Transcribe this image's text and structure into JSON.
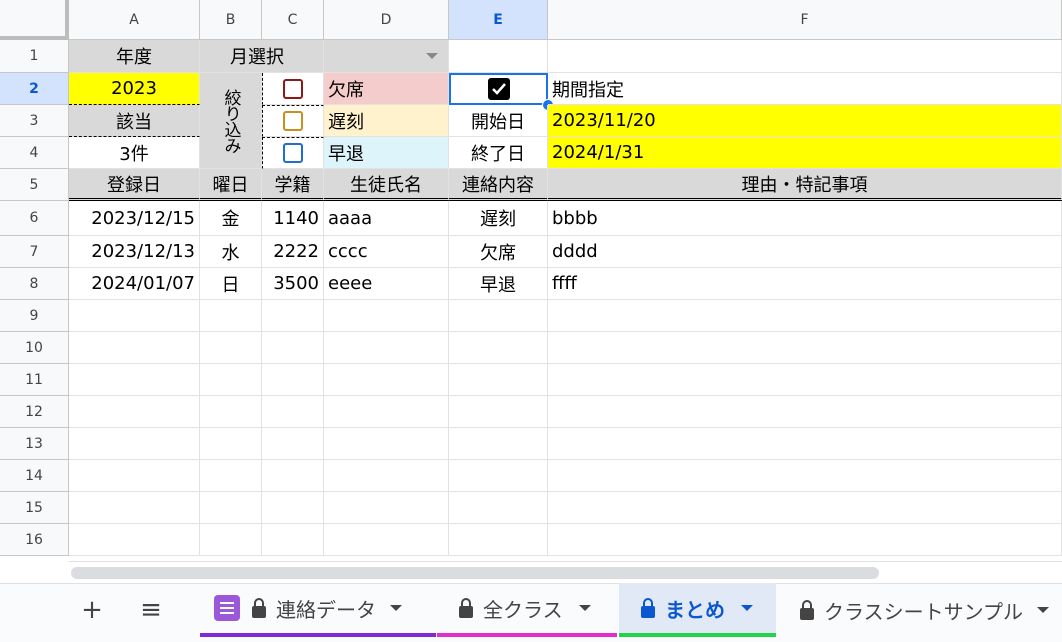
{
  "columns": [
    "A",
    "B",
    "C",
    "D",
    "E",
    "F"
  ],
  "rows": [
    "1",
    "2",
    "3",
    "4",
    "5",
    "6",
    "7",
    "8",
    "9",
    "10",
    "11",
    "12",
    "13",
    "14",
    "15",
    "16"
  ],
  "header": {
    "year_label": "年度",
    "year_value": "2023",
    "match_label": "該当",
    "match_value": "3件",
    "month_select_label": "月選択",
    "filter_label": "絞り込み",
    "absent": "欠席",
    "late": "遅刻",
    "early": "早退",
    "period_label": "期間指定",
    "start_label": "開始日",
    "start_value": "2023/11/20",
    "end_label": "終了日",
    "end_value": "2024/1/31"
  },
  "table": {
    "headers": [
      "登録日",
      "曜日",
      "学籍",
      "生徒氏名",
      "連絡内容",
      "理由・特記事項"
    ],
    "rows": [
      [
        "2023/12/15",
        "金",
        "1140",
        "aaaa",
        "遅刻",
        "bbbb"
      ],
      [
        "2023/12/13",
        "水",
        "2222",
        "cccc",
        "欠席",
        "dddd"
      ],
      [
        "2024/01/07",
        "日",
        "3500",
        "eeee",
        "早退",
        "ffff"
      ]
    ]
  },
  "tabs": {
    "add": "+",
    "menu": "≡",
    "items": [
      {
        "label": "連絡データ",
        "color": "#7b2cd6"
      },
      {
        "label": "全クラス",
        "color": "#e02fce"
      },
      {
        "label": "まとめ",
        "color": "#23d44b"
      },
      {
        "label": "クラスシートサンプル",
        "color": ""
      }
    ]
  },
  "colors": {
    "accent": "#0b57d0",
    "yellow": "#ffff00",
    "absent_box": "#8b1a1a",
    "late_box": "#c8911e",
    "early_box": "#1f6fd1"
  }
}
